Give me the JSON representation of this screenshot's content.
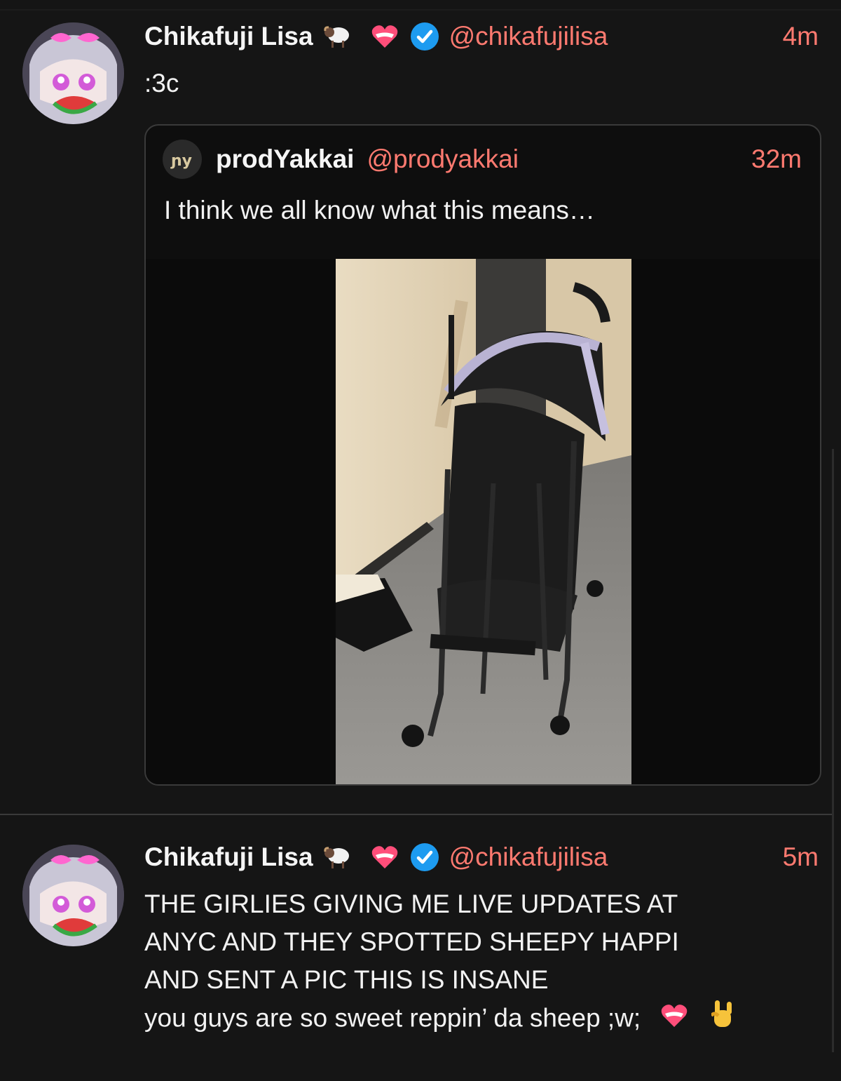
{
  "posts": [
    {
      "author_name": "Chikafuji Lisa",
      "emoji_icons": [
        "sheep-icon",
        "heart-icon",
        "verified-badge-icon"
      ],
      "handle": "@chikafujilisa",
      "time": "4m",
      "text": ":3c",
      "quote": {
        "author_name": "prodYakkai",
        "handle": "@prodyakkai",
        "time": "32m",
        "text": "I think we all know what this means…",
        "image": "stroller-photo"
      }
    },
    {
      "author_name": "Chikafuji Lisa",
      "emoji_icons": [
        "sheep-icon",
        "heart-icon",
        "verified-badge-icon"
      ],
      "handle": "@chikafujilisa",
      "time": "5m",
      "lines": [
        "THE GIRLIES GIVING ME LIVE UPDATES AT",
        "ANYC AND THEY SPOTTED SHEEPY HAPPI",
        "AND SENT A PIC THIS IS INSANE",
        "you guys are so sweet reppin’ da sheep ;w;"
      ],
      "trailing_icons": [
        "heart-icon",
        "rock-hand-icon"
      ]
    }
  ],
  "colors": {
    "background": "#151515",
    "accent": "#ff7a70",
    "verified": "#1d9bf0"
  }
}
